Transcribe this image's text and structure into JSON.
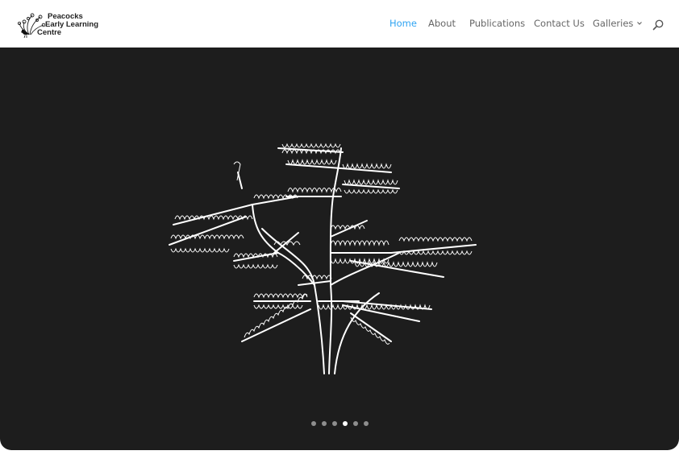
{
  "header": {
    "logo": {
      "line1": "Peacocks",
      "line2": "Early Learning",
      "line3": "Centre"
    },
    "nav": [
      {
        "label": "Home",
        "active": true
      },
      {
        "label": "About",
        "active": false
      },
      {
        "label": "Publications",
        "active": false
      },
      {
        "label": "Contact Us",
        "active": false
      },
      {
        "label": "Galleries",
        "active": false,
        "has_dropdown": true
      }
    ],
    "search_icon": "search-icon"
  },
  "hero": {
    "image": "tree-line-drawing",
    "slider": {
      "count": 6,
      "active_index": 3
    }
  },
  "colors": {
    "accent": "#2ea3f2",
    "nav_text": "#666666",
    "hero_bg": "#1d1d1d"
  }
}
